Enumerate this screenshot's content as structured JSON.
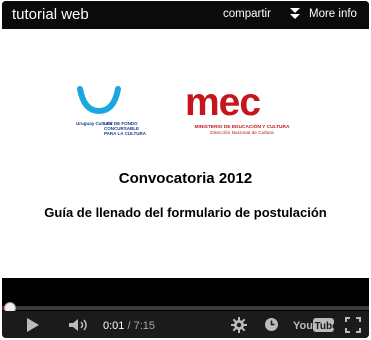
{
  "player": {
    "title": "tutorial web",
    "share_label": "compartir",
    "more_info_label": "More info",
    "current_time": "0:01",
    "separator": " / ",
    "duration": "7:15",
    "progress_fraction": 0.002,
    "accent_color": "#cc0000"
  },
  "video_frame": {
    "left_logo_caption_1": "Uruguay Cultural",
    "left_logo_caption_2": "LEY DE FONDO",
    "left_logo_caption_3": "CONCURSABLE",
    "left_logo_caption_4": "PARA LA CULTURA",
    "mec_logo": "mec",
    "mec_subtitle_1": "MINISTERIO DE EDUCACIÓN Y CULTURA",
    "mec_subtitle_2": "Dirección Nacional de Cultura",
    "heading": "Convocatoria 2012",
    "subheading": "Guía de llenado del formulario de postulación"
  },
  "icons": {
    "more": "double-chevron-down-icon",
    "play": "play-icon",
    "volume": "volume-icon",
    "settings": "gear-icon",
    "watch_later": "clock-icon",
    "youtube": "youtube-logo",
    "fullscreen": "fullscreen-icon"
  }
}
